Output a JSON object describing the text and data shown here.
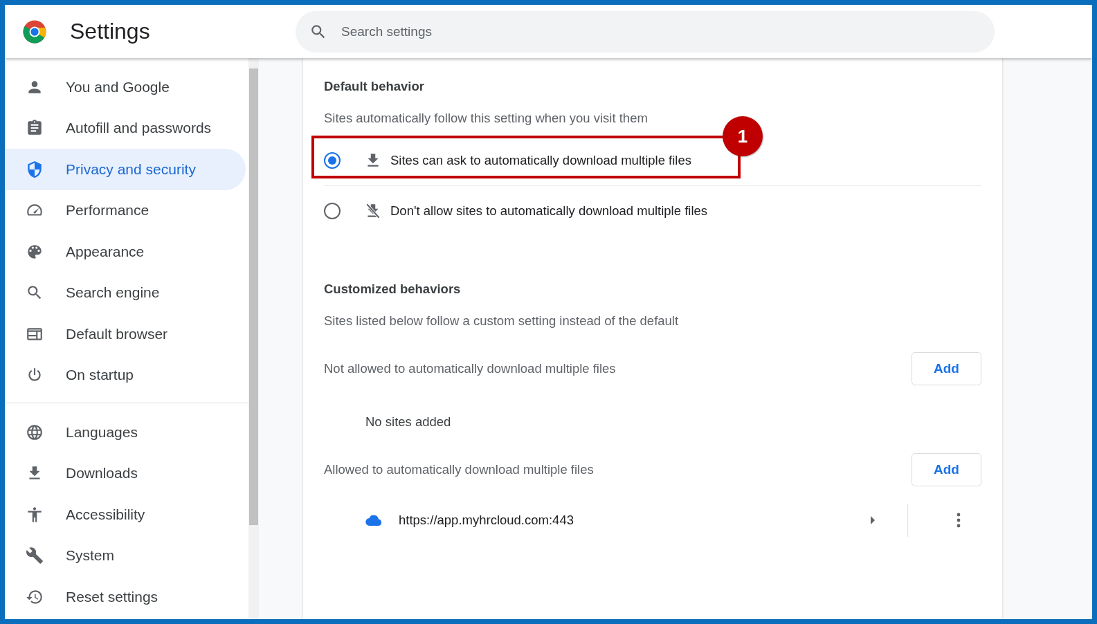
{
  "header": {
    "title": "Settings",
    "search": {
      "placeholder": "Search settings"
    }
  },
  "sidebar": {
    "sections": [
      {
        "items": [
          {
            "label": "You and Google",
            "selected": false
          },
          {
            "label": "Autofill and passwords",
            "selected": false
          },
          {
            "label": "Privacy and security",
            "selected": true
          },
          {
            "label": "Performance",
            "selected": false
          },
          {
            "label": "Appearance",
            "selected": false
          },
          {
            "label": "Search engine",
            "selected": false
          },
          {
            "label": "Default browser",
            "selected": false
          },
          {
            "label": "On startup",
            "selected": false
          }
        ]
      },
      {
        "items": [
          {
            "label": "Languages",
            "selected": false
          },
          {
            "label": "Downloads",
            "selected": false
          },
          {
            "label": "Accessibility",
            "selected": false
          },
          {
            "label": "System",
            "selected": false
          },
          {
            "label": "Reset settings",
            "selected": false
          }
        ]
      }
    ]
  },
  "default_behavior": {
    "title": "Default behavior",
    "description": "Sites automatically follow this setting when you visit them",
    "options": [
      {
        "label": "Sites can ask to automatically download multiple files",
        "selected": true,
        "callout": "1"
      },
      {
        "label": "Don't allow sites to automatically download multiple files",
        "selected": false
      }
    ]
  },
  "customized": {
    "title": "Customized behaviors",
    "description": "Sites listed below follow a custom setting instead of the default",
    "lists": [
      {
        "title": "Not allowed to automatically download multiple files",
        "button": "Add",
        "empty_text": "No sites added"
      },
      {
        "title": "Allowed to automatically download multiple files",
        "button": "Add",
        "sites": [
          {
            "url": "https://app.myhrcloud.com:443"
          }
        ]
      }
    ]
  }
}
